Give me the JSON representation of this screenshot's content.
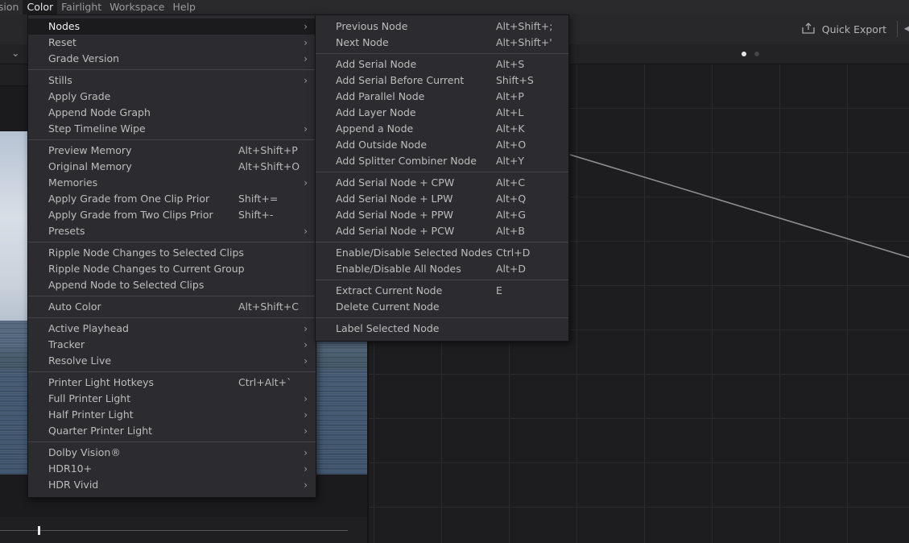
{
  "menubar": [
    "usion",
    "Color",
    "Fairlight",
    "Workspace",
    "Help"
  ],
  "toolbar": {
    "quick_export": "Quick Export",
    "arrow": "◂"
  },
  "subbar": {
    "chevron": "⌄"
  },
  "colors": {
    "menu_bg": "#2c2c30",
    "highlight": "#1b1b1d",
    "graph_bg": "#1d1d20"
  },
  "main_menu": [
    [
      {
        "label": "Nodes",
        "shortcut": "",
        "submenu": true,
        "highlight": true
      },
      {
        "label": "Reset",
        "shortcut": "",
        "submenu": true
      },
      {
        "label": "Grade Version",
        "shortcut": "",
        "submenu": true
      }
    ],
    [
      {
        "label": "Stills",
        "shortcut": "",
        "submenu": true
      },
      {
        "label": "Apply Grade",
        "shortcut": ""
      },
      {
        "label": "Append Node Graph",
        "shortcut": ""
      },
      {
        "label": "Step Timeline Wipe",
        "shortcut": "",
        "submenu": true
      }
    ],
    [
      {
        "label": "Preview Memory",
        "shortcut": "Alt+Shift+P"
      },
      {
        "label": "Original Memory",
        "shortcut": "Alt+Shift+O"
      },
      {
        "label": "Memories",
        "shortcut": "",
        "submenu": true
      },
      {
        "label": "Apply Grade from One Clip Prior",
        "shortcut": "Shift+="
      },
      {
        "label": "Apply Grade from Two Clips Prior",
        "shortcut": "Shift+-"
      },
      {
        "label": "Presets",
        "shortcut": "",
        "submenu": true
      }
    ],
    [
      {
        "label": "Ripple Node Changes to Selected Clips",
        "shortcut": ""
      },
      {
        "label": "Ripple Node Changes to Current Group",
        "shortcut": ""
      },
      {
        "label": "Append Node to Selected Clips",
        "shortcut": ""
      }
    ],
    [
      {
        "label": "Auto Color",
        "shortcut": "Alt+Shift+C"
      }
    ],
    [
      {
        "label": "Active Playhead",
        "shortcut": "",
        "submenu": true
      },
      {
        "label": "Tracker",
        "shortcut": "",
        "submenu": true
      },
      {
        "label": "Resolve Live",
        "shortcut": "",
        "submenu": true
      }
    ],
    [
      {
        "label": "Printer Light Hotkeys",
        "shortcut": "Ctrl+Alt+`"
      },
      {
        "label": "Full Printer Light",
        "shortcut": "",
        "submenu": true
      },
      {
        "label": "Half Printer Light",
        "shortcut": "",
        "submenu": true
      },
      {
        "label": "Quarter Printer Light",
        "shortcut": "",
        "submenu": true
      }
    ],
    [
      {
        "label": "Dolby Vision®",
        "shortcut": "",
        "submenu": true
      },
      {
        "label": "HDR10+",
        "shortcut": "",
        "submenu": true
      },
      {
        "label": "HDR Vivid",
        "shortcut": "",
        "submenu": true
      }
    ]
  ],
  "nodes_menu": [
    [
      {
        "label": "Previous Node",
        "shortcut": "Alt+Shift+;"
      },
      {
        "label": "Next Node",
        "shortcut": "Alt+Shift+'"
      }
    ],
    [
      {
        "label": "Add Serial Node",
        "shortcut": "Alt+S"
      },
      {
        "label": "Add Serial Before Current",
        "shortcut": "Shift+S"
      },
      {
        "label": "Add Parallel Node",
        "shortcut": "Alt+P"
      },
      {
        "label": "Add Layer Node",
        "shortcut": "Alt+L"
      },
      {
        "label": "Append a Node",
        "shortcut": "Alt+K"
      },
      {
        "label": "Add Outside Node",
        "shortcut": "Alt+O"
      },
      {
        "label": "Add Splitter Combiner Node",
        "shortcut": "Alt+Y"
      }
    ],
    [
      {
        "label": "Add Serial Node + CPW",
        "shortcut": "Alt+C"
      },
      {
        "label": "Add Serial Node + LPW",
        "shortcut": "Alt+Q"
      },
      {
        "label": "Add Serial Node + PPW",
        "shortcut": "Alt+G"
      },
      {
        "label": "Add Serial Node + PCW",
        "shortcut": "Alt+B"
      }
    ],
    [
      {
        "label": "Enable/Disable Selected Nodes",
        "shortcut": "Ctrl+D"
      },
      {
        "label": "Enable/Disable All Nodes",
        "shortcut": "Alt+D"
      }
    ],
    [
      {
        "label": "Extract Current Node",
        "shortcut": "E"
      },
      {
        "label": "Delete Current Node",
        "shortcut": ""
      }
    ],
    [
      {
        "label": "Label Selected Node",
        "shortcut": ""
      }
    ]
  ]
}
